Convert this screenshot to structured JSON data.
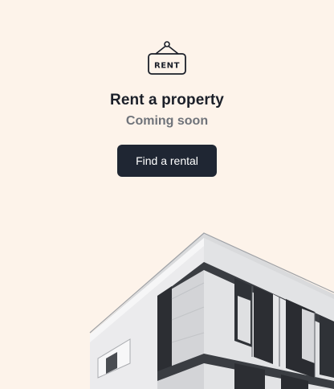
{
  "card": {
    "sign_text": "RENT",
    "title": "Rent a property",
    "subtitle": "Coming soon",
    "cta_label": "Find a rental"
  },
  "icons": {
    "sign": "rent-sign-icon",
    "image": "building-photo"
  },
  "colors": {
    "background": "#fdf3ea",
    "button": "#1f2633",
    "title": "#1b1f29",
    "subtitle": "#6f737a"
  }
}
